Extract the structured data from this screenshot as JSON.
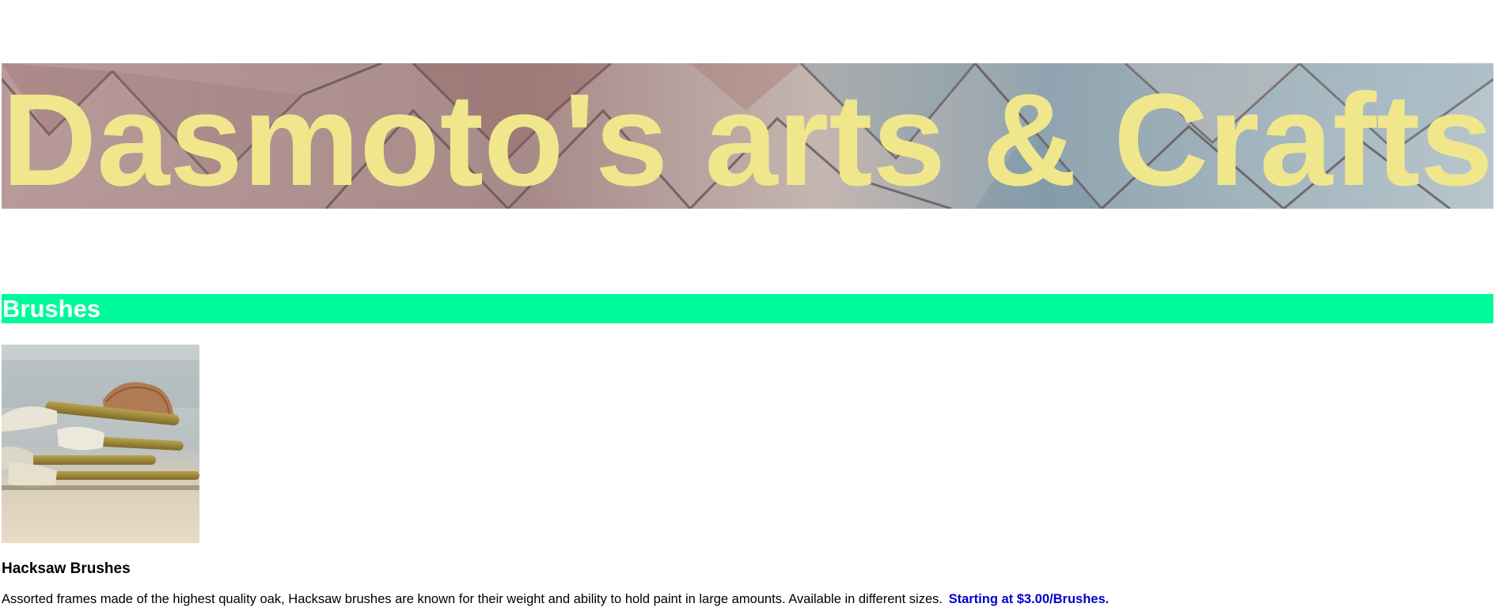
{
  "header": {
    "title": "Dasmoto's arts & Crafts"
  },
  "sections": [
    {
      "title": "Brushes",
      "products": [
        {
          "name": "Hacksaw Brushes",
          "description": "Assorted frames made of the highest quality oak, Hacksaw brushes are known for their weight and ability to hold paint in large amounts. Available in different sizes.",
          "price": "Starting at $3.00/Brushes."
        }
      ]
    }
  ],
  "colors": {
    "title_text": "#f0e68c",
    "section_bar": "#00fa9a",
    "section_text": "#ffffff",
    "price_text": "#0000cd"
  }
}
